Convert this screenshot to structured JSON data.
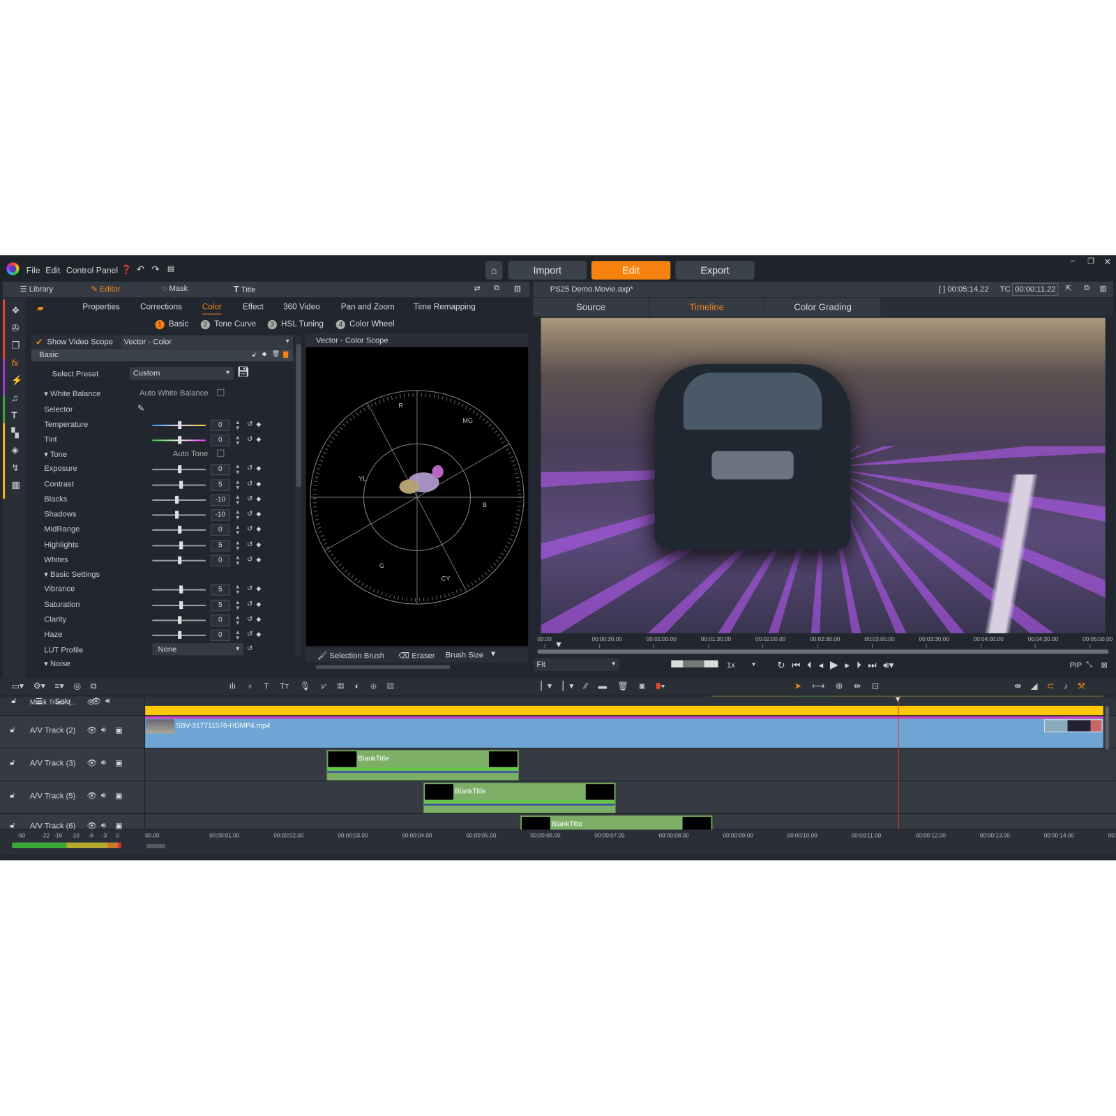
{
  "menu": {
    "items": [
      "File",
      "Edit",
      "Control Panel"
    ],
    "icons": [
      "help-icon",
      "undo-icon",
      "redo-icon",
      "document-icon"
    ]
  },
  "modes": {
    "import": "Import",
    "edit": "Edit",
    "export": "Export",
    "active": "Edit"
  },
  "window_controls": [
    "minimize",
    "restore",
    "close"
  ],
  "left_tabs": [
    "Library",
    "Editor",
    "Mask",
    "Title"
  ],
  "editor_tabs": [
    "Properties",
    "Corrections",
    "Color",
    "Effect",
    "360 Video",
    "Pan and Zoom",
    "Time Remapping"
  ],
  "active_editor_tab": "Color",
  "color_subtabs": [
    {
      "n": "1",
      "label": "Basic"
    },
    {
      "n": "2",
      "label": "Tone Curve"
    },
    {
      "n": "3",
      "label": "HSL Tuning"
    },
    {
      "n": "4",
      "label": "Color Wheel"
    }
  ],
  "scope": {
    "show_label": "Show Video Scope",
    "checked": true,
    "type": "Vector - Color",
    "title": "Vector - Color Scope",
    "labels": [
      "R",
      "MG",
      "B",
      "CY",
      "G",
      "YL"
    ]
  },
  "basic": {
    "section": "Basic",
    "preset_label": "Select Preset",
    "preset_value": "Custom",
    "white_balance": "White Balance",
    "auto_wb": "Auto White Balance",
    "selector": "Selector",
    "tone": "Tone",
    "auto_tone": "Auto Tone",
    "basic_settings": "Basic Settings",
    "lut_label": "LUT Profile",
    "lut_value": "None",
    "noise": "Noise",
    "params": [
      {
        "label": "Temperature",
        "value": "0",
        "pos": 0.5
      },
      {
        "label": "Tint",
        "value": "0",
        "pos": 0.5
      },
      {
        "label": "Exposure",
        "value": "0",
        "pos": 0.5
      },
      {
        "label": "Contrast",
        "value": "5",
        "pos": 0.53
      },
      {
        "label": "Blacks",
        "value": "-10",
        "pos": 0.45
      },
      {
        "label": "Shadows",
        "value": "-10",
        "pos": 0.45
      },
      {
        "label": "MidRange",
        "value": "0",
        "pos": 0.5
      },
      {
        "label": "Highlights",
        "value": "5",
        "pos": 0.53
      },
      {
        "label": "Whites",
        "value": "0",
        "pos": 0.5
      },
      {
        "label": "Vibrance",
        "value": "5",
        "pos": 0.53
      },
      {
        "label": "Saturation",
        "value": "5",
        "pos": 0.53
      },
      {
        "label": "Clarity",
        "value": "0",
        "pos": 0.5
      },
      {
        "label": "Haze",
        "value": "0",
        "pos": 0.5
      }
    ]
  },
  "brush": {
    "selection": "Selection Brush",
    "eraser": "Eraser",
    "size": "Brush Size"
  },
  "preview": {
    "project": "PS25 Demo.Movie.axp*",
    "duration": "[ ] 00:05:14.22",
    "tc_label": "TC",
    "tc": "00:00:11.22",
    "tabs": [
      "Source",
      "Timeline",
      "Color Grading"
    ],
    "active_tab": "Timeline",
    "ruler": [
      "00.00",
      "00:00:30.00",
      "00:01:00.00",
      "00:01:30.00",
      "00:02:00.00",
      "00:02:30.00",
      "00:03:00.00",
      "00:03:30.00",
      "00:04:00.00",
      "00:04:30.00",
      "00:05:00.00"
    ],
    "zoom": "Fit",
    "speed": "1x",
    "pip": "PiP"
  },
  "timeline": {
    "solo": "Solo",
    "tracks": [
      "Mask Track (...",
      "A/V Track (2)",
      "A/V Track (3)",
      "A/V Track (5)",
      "A/V Track (6)"
    ],
    "main_clip": "SBV-317711576-HDMP4.mp4",
    "title_clip": "BlankTitle",
    "ruler": [
      "00.00",
      "00:00:01.00",
      "00:00:02.00",
      "00:00:03.00",
      "00:00:04.00",
      "00:00:05.00",
      "00:00:06.00",
      "00:00:07.00",
      "00:00:08.00",
      "00:00:09.00",
      "00:00:10.00",
      "00:00:11.00",
      "00:00:12.00",
      "00:00:13.00",
      "00:00:14.00",
      "00:0"
    ],
    "meter": [
      "-60",
      "-22",
      "-16",
      "-10",
      "-6",
      "-3",
      "0"
    ]
  },
  "colors": {
    "accent": "#f5820f",
    "clip_video": "#6fa5d4",
    "clip_title": "#7eaf66",
    "mask_bar": "#ffc800",
    "playhead": "#e03a2a"
  }
}
